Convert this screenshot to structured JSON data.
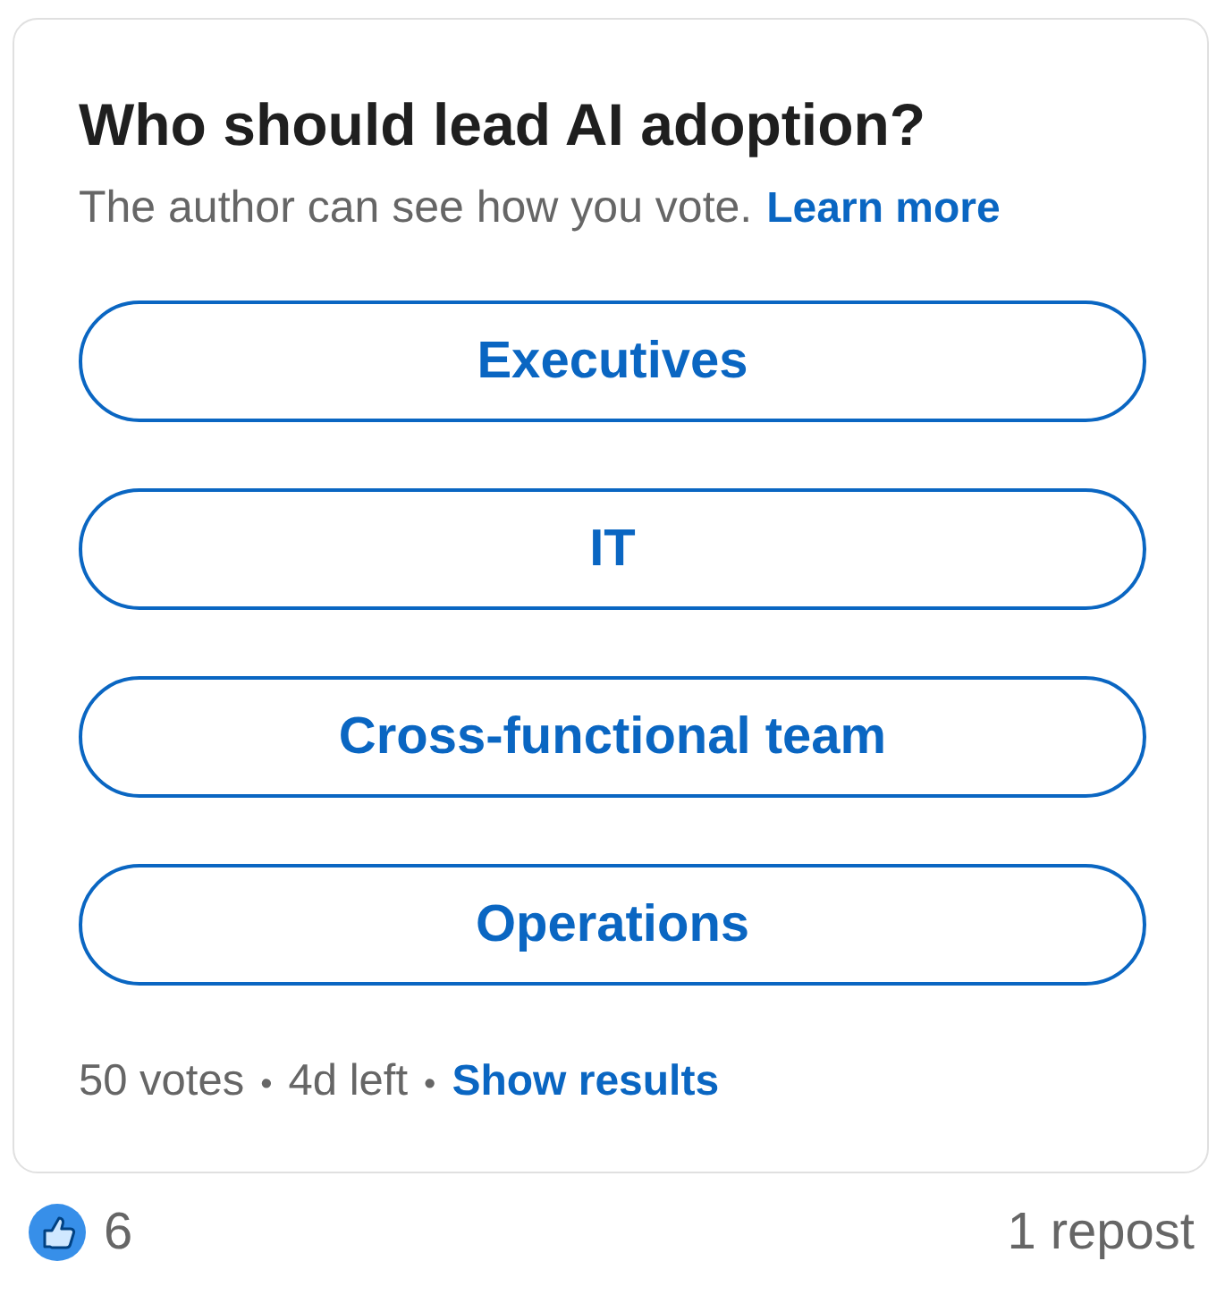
{
  "poll": {
    "question": "Who should lead AI adoption?",
    "note": "The author can see how you vote.",
    "note_link": "Learn more",
    "options": [
      {
        "label": "Executives"
      },
      {
        "label": "IT"
      },
      {
        "label": "Cross-functional team"
      },
      {
        "label": "Operations"
      }
    ],
    "footer": [
      {
        "kind": "text",
        "text": "50 votes"
      },
      {
        "kind": "separator",
        "text": "•"
      },
      {
        "kind": "text",
        "text": "4d left"
      },
      {
        "kind": "separator",
        "text": "•"
      },
      {
        "kind": "link",
        "text": "Show results"
      }
    ]
  },
  "social_counts": {
    "reactions": "6",
    "reposts": "1 repost"
  }
}
